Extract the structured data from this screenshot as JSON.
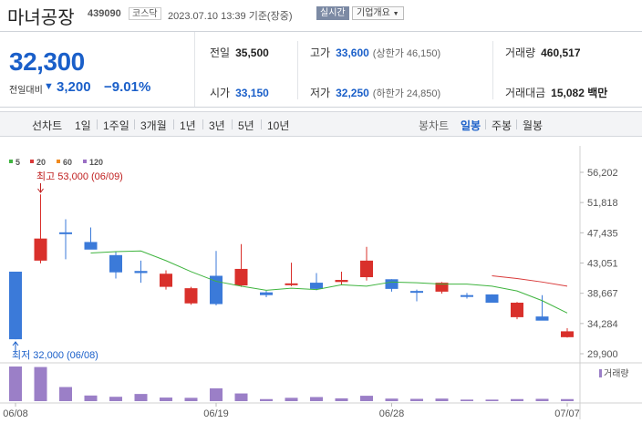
{
  "header": {
    "name": "마녀공장",
    "code": "439090",
    "market": "코스닥",
    "datetime": "2023.07.10 13:39 기준(장중)",
    "realtime": "실시간",
    "company": "기업개요",
    "company_icon": "caret-down-icon"
  },
  "summary": {
    "price": "32,300",
    "change_label": "전일대비",
    "change_icon": "triangle-down-icon",
    "change": "3,200",
    "change_pct": "−9.01%",
    "prev_label": "전일",
    "prev": "35,500",
    "high_label": "고가",
    "high": "33,600",
    "upper_limit": "(상한가 46,150)",
    "volume_label": "거래량",
    "volume": "460,517",
    "open_label": "시가",
    "open": "33,150",
    "low_label": "저가",
    "low": "32,250",
    "lower_limit": "(하한가 24,850)",
    "amount_label": "거래대금",
    "amount": "15,082 백만",
    "colors": {
      "down": "#1a5fc9",
      "up": "#d12020"
    }
  },
  "periods": {
    "line_label": "선차트",
    "line_items": [
      "1일",
      "1주일",
      "3개월",
      "1년",
      "3년",
      "5년",
      "10년"
    ],
    "candle_label": "봉차트",
    "candle_items": [
      "일봉",
      "주봉",
      "월봉"
    ],
    "active": "일봉"
  },
  "chart_data": {
    "type": "candlestick",
    "legend": [
      {
        "name": "5",
        "color": "#3fb43f"
      },
      {
        "name": "20",
        "color": "#d93a3a"
      },
      {
        "name": "60",
        "color": "#f08a1f"
      },
      {
        "name": "120",
        "color": "#9a6fc4"
      }
    ],
    "y_ticks": [
      "56,202",
      "51,818",
      "47,435",
      "43,051",
      "38,667",
      "34,284",
      "29,900"
    ],
    "y_range": [
      29900,
      56202
    ],
    "x_labels": [
      {
        "label": "06/08",
        "index": 0
      },
      {
        "label": "06/19",
        "index": 8
      },
      {
        "label": "06/28",
        "index": 15
      },
      {
        "label": "07/07",
        "index": 22
      }
    ],
    "max_note": "최고 53,000 (06/09)",
    "min_note": "최저 32,000 (06/08)",
    "volume_label": "거래량",
    "candles": [
      {
        "o": 41800,
        "h": 41800,
        "l": 32000,
        "c": 32000
      },
      {
        "o": 43400,
        "h": 53000,
        "l": 43000,
        "c": 46600
      },
      {
        "o": 47500,
        "h": 49400,
        "l": 43600,
        "c": 47300
      },
      {
        "o": 46100,
        "h": 48200,
        "l": 45300,
        "c": 45000
      },
      {
        "o": 44200,
        "h": 44700,
        "l": 40800,
        "c": 41700
      },
      {
        "o": 41900,
        "h": 43400,
        "l": 40200,
        "c": 41600
      },
      {
        "o": 39600,
        "h": 42000,
        "l": 39200,
        "c": 41500
      },
      {
        "o": 37200,
        "h": 39600,
        "l": 37000,
        "c": 39400
      },
      {
        "o": 41200,
        "h": 44800,
        "l": 36900,
        "c": 37100
      },
      {
        "o": 39800,
        "h": 45800,
        "l": 39600,
        "c": 42200
      },
      {
        "o": 38800,
        "h": 39000,
        "l": 38100,
        "c": 38400
      },
      {
        "o": 39900,
        "h": 43100,
        "l": 39700,
        "c": 40100
      },
      {
        "o": 40200,
        "h": 41600,
        "l": 39100,
        "c": 39300
      },
      {
        "o": 40300,
        "h": 41800,
        "l": 39900,
        "c": 40600
      },
      {
        "o": 41000,
        "h": 45400,
        "l": 40500,
        "c": 43400
      },
      {
        "o": 40700,
        "h": 40700,
        "l": 38900,
        "c": 39300
      },
      {
        "o": 39000,
        "h": 39200,
        "l": 37500,
        "c": 38800
      },
      {
        "o": 38900,
        "h": 40300,
        "l": 38600,
        "c": 40200
      },
      {
        "o": 38400,
        "h": 38700,
        "l": 37900,
        "c": 38200
      },
      {
        "o": 38500,
        "h": 38500,
        "l": 37300,
        "c": 37300
      },
      {
        "o": 35200,
        "h": 37400,
        "l": 34900,
        "c": 37300
      },
      {
        "o": 35300,
        "h": 38400,
        "l": 35000,
        "c": 34700
      },
      {
        "o": 32300,
        "h": 33600,
        "l": 32250,
        "c": 33150
      }
    ],
    "ma5": [
      null,
      null,
      null,
      44500,
      44700,
      44800,
      43400,
      41800,
      40400,
      39700,
      39100,
      39400,
      39200,
      39900,
      39700,
      40300,
      40200,
      40000,
      40000,
      39700,
      39000,
      37600,
      35800
    ],
    "ma20": [
      null,
      null,
      null,
      null,
      null,
      null,
      null,
      null,
      null,
      null,
      null,
      null,
      null,
      null,
      null,
      null,
      null,
      null,
      null,
      41200,
      40800,
      40300,
      39700
    ],
    "volumes": [
      135,
      133,
      55,
      22,
      17,
      28,
      14,
      13,
      50,
      30,
      8,
      13,
      16,
      11,
      21,
      10,
      9,
      10,
      6,
      6,
      8,
      9,
      8
    ]
  }
}
